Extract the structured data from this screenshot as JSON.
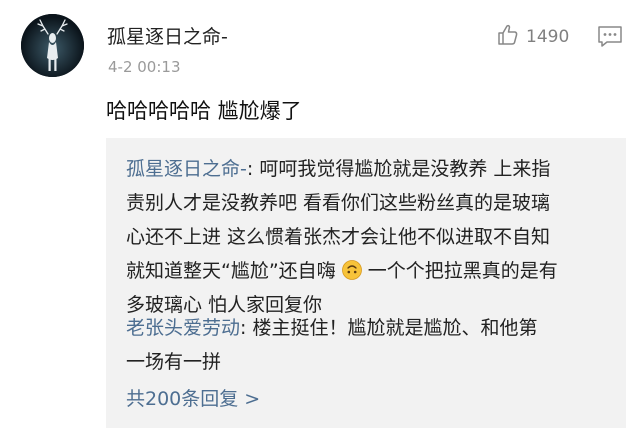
{
  "comment": {
    "username": "孤星逐日之命-",
    "timestamp": "4-2 00:13",
    "likes": "1490",
    "text": "哈哈哈哈哈 尴尬爆了"
  },
  "replies": [
    {
      "author": "孤星逐日之命-",
      "separator": ": ",
      "lines": [
        "呵呵我觉得尴尬就是没教养 上来指",
        "责别人才是没教养吧 看看你们这些粉丝真的是玻璃",
        "心还不上进 这么惯着张杰才会让他不似进取不自知",
        "就知道整天“尴尬”还自嗨",
        "一个个把拉黑真的是有",
        "多玻璃心 怕人家回复你"
      ]
    },
    {
      "author": "老张头爱劳动",
      "separator": ": ",
      "lines": [
        "楼主挺住！尴尬就是尴尬、和他第",
        "一场有一拼"
      ]
    }
  ],
  "total_replies": "共200条回复 >",
  "icons": {
    "like": "thumbs-up-icon",
    "comment": "comment-icon",
    "emoji": "upside-down-face-emoji"
  },
  "colors": {
    "link": "#4d6e91",
    "meta": "#9a9a9a",
    "reply_bg": "#f2f2f2"
  }
}
